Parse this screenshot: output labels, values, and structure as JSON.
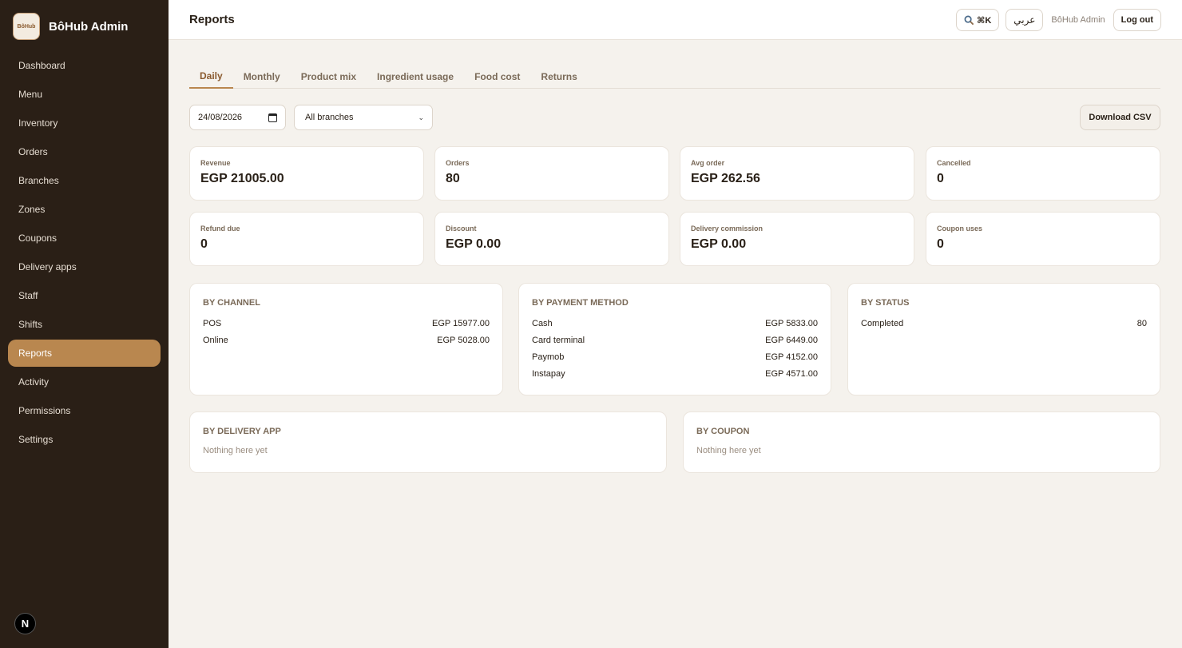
{
  "app": {
    "name": "BôHub Admin",
    "logo_text": "BôHub"
  },
  "sidebar": {
    "items": [
      {
        "label": "Dashboard"
      },
      {
        "label": "Menu"
      },
      {
        "label": "Inventory"
      },
      {
        "label": "Orders"
      },
      {
        "label": "Branches"
      },
      {
        "label": "Zones"
      },
      {
        "label": "Coupons"
      },
      {
        "label": "Delivery apps"
      },
      {
        "label": "Staff"
      },
      {
        "label": "Shifts"
      },
      {
        "label": "Reports"
      },
      {
        "label": "Activity"
      },
      {
        "label": "Permissions"
      },
      {
        "label": "Settings"
      }
    ],
    "active": "Reports",
    "badge": "N"
  },
  "header": {
    "title": "Reports",
    "search_shortcut": "⌘K",
    "language": "عربي",
    "user": "BôHub Admin",
    "logout": "Log out"
  },
  "tabs": [
    "Daily",
    "Monthly",
    "Product mix",
    "Ingredient usage",
    "Food cost",
    "Returns"
  ],
  "active_tab": "Daily",
  "filters": {
    "date": "24/08/2026",
    "branch": "All branches",
    "download": "Download CSV"
  },
  "stats": [
    {
      "label": "Revenue",
      "value": "EGP 21005.00"
    },
    {
      "label": "Orders",
      "value": "80"
    },
    {
      "label": "Avg order",
      "value": "EGP 262.56"
    },
    {
      "label": "Cancelled",
      "value": "0"
    },
    {
      "label": "Refund due",
      "value": "0"
    },
    {
      "label": "Discount",
      "value": "EGP 0.00"
    },
    {
      "label": "Delivery commission",
      "value": "EGP 0.00"
    },
    {
      "label": "Coupon uses",
      "value": "0"
    }
  ],
  "by_channel": {
    "title": "BY CHANNEL",
    "rows": [
      [
        "POS",
        "EGP 15977.00"
      ],
      [
        "Online",
        "EGP 5028.00"
      ]
    ]
  },
  "by_payment": {
    "title": "BY PAYMENT METHOD",
    "rows": [
      [
        "Cash",
        "EGP 5833.00"
      ],
      [
        "Card terminal",
        "EGP 6449.00"
      ],
      [
        "Paymob",
        "EGP 4152.00"
      ],
      [
        "Instapay",
        "EGP 4571.00"
      ]
    ]
  },
  "by_status": {
    "title": "BY STATUS",
    "rows": [
      [
        "Completed",
        "80"
      ]
    ]
  },
  "by_delivery_app": {
    "title": "BY DELIVERY APP",
    "empty": "Nothing here yet"
  },
  "by_coupon": {
    "title": "BY COUPON",
    "empty": "Nothing here yet"
  }
}
